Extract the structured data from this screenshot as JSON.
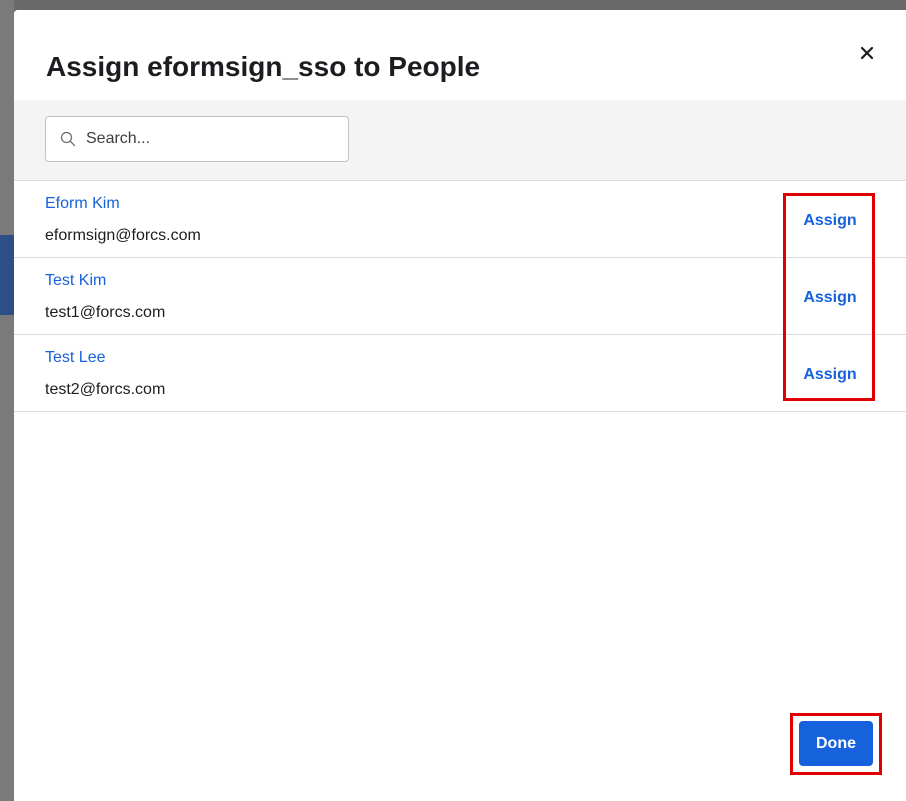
{
  "modal": {
    "title": "Assign eformsign_sso to People",
    "close_icon": "close-icon"
  },
  "search": {
    "placeholder": "Search...",
    "value": "",
    "icon": "search-icon"
  },
  "users": [
    {
      "name": "Eform Kim",
      "email": "eformsign@forcs.com",
      "action_label": "Assign"
    },
    {
      "name": "Test Kim",
      "email": "test1@forcs.com",
      "action_label": "Assign"
    },
    {
      "name": "Test Lee",
      "email": "test2@forcs.com",
      "action_label": "Assign"
    }
  ],
  "footer": {
    "done_label": "Done"
  },
  "colors": {
    "accent": "#1662dd",
    "highlight": "#e00000",
    "text": "#1d1d21",
    "toolbar_bg": "#f4f4f5"
  }
}
